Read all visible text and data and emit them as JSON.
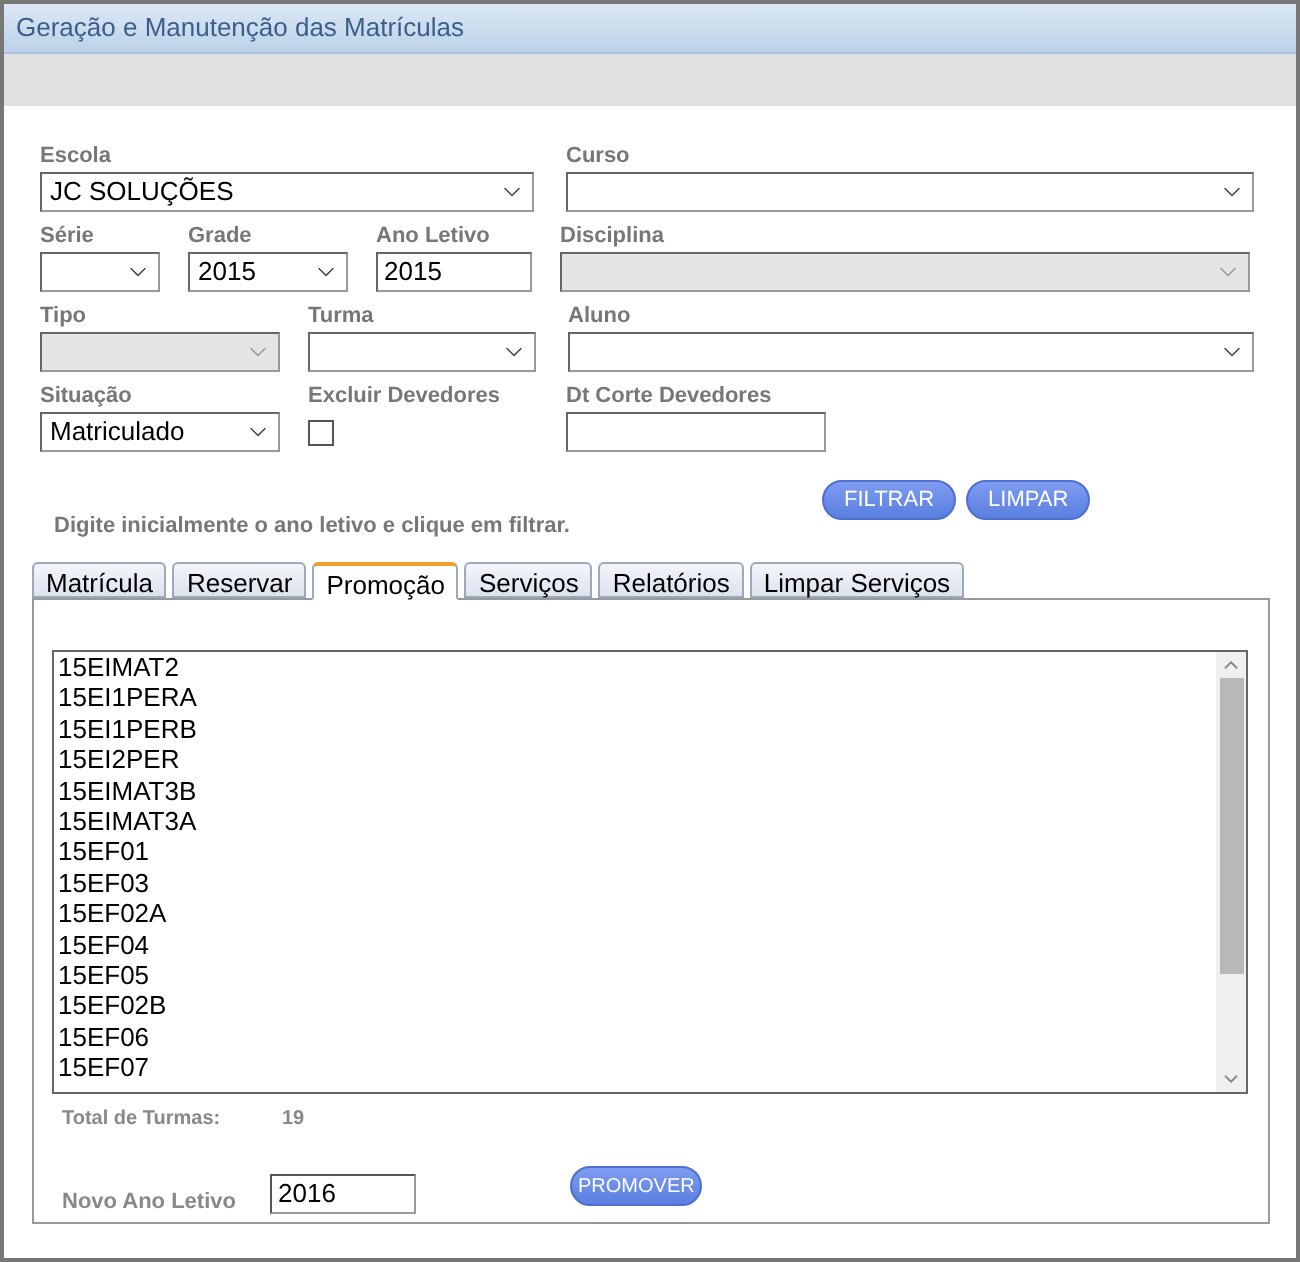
{
  "window": {
    "title": "Geração e Manutenção das Matrículas"
  },
  "form_rows": [
    [
      {
        "label": "Escola",
        "kind": "select",
        "value": "JC SOLUÇÕES",
        "disabled": false
      },
      {
        "label": "Curso",
        "kind": "select",
        "disabled": false
      }
    ],
    [
      {
        "label": "Série",
        "kind": "select",
        "disabled": false
      },
      {
        "label": "Grade",
        "kind": "select",
        "value": "2015",
        "disabled": false
      },
      {
        "label": "Ano Letivo",
        "kind": "input",
        "value": "2015",
        "disabled": false
      },
      {
        "label": "Disciplina",
        "kind": "select",
        "disabled": true
      }
    ],
    [
      {
        "label": "Tipo",
        "kind": "select",
        "disabled": true
      },
      {
        "label": "Turma",
        "kind": "select",
        "disabled": false
      },
      {
        "label": "Aluno",
        "kind": "select",
        "disabled": false
      }
    ],
    [
      {
        "label": "Situação",
        "kind": "select",
        "value": "Matriculado",
        "disabled": false
      },
      {
        "label": "Excluir Devedores",
        "kind": "checkbox",
        "checked": false
      },
      {
        "label": "Dt Corte Devedores",
        "kind": "input",
        "disabled": false
      }
    ]
  ],
  "hint": "Digite inicialmente o ano letivo e clique em filtrar.",
  "filter_buttons": [
    "FILTRAR",
    "LIMPAR"
  ],
  "tabs": [
    {
      "label": "Matrícula",
      "selected": false
    },
    {
      "label": "Reservar",
      "selected": false
    },
    {
      "label": "Promoção",
      "selected": true
    },
    {
      "label": "Serviços",
      "selected": false
    },
    {
      "label": "Relatórios",
      "selected": false
    },
    {
      "label": "Limpar Serviços",
      "selected": false
    }
  ],
  "class_list": [
    "15EIMAT2",
    "15EI1PERA",
    "15EI1PERB",
    "15EI2PER",
    "15EIMAT3B",
    "15EIMAT3A",
    "15EF01",
    "15EF03",
    "15EF02A",
    "15EF04",
    "15EF05",
    "15EF02B",
    "15EF06",
    "15EF07"
  ],
  "total": {
    "label": "Total de Turmas:",
    "value": "19"
  },
  "new_year": {
    "label": "Novo Ano Letivo",
    "value": "2016"
  },
  "promote_button": "PROMOVER"
}
